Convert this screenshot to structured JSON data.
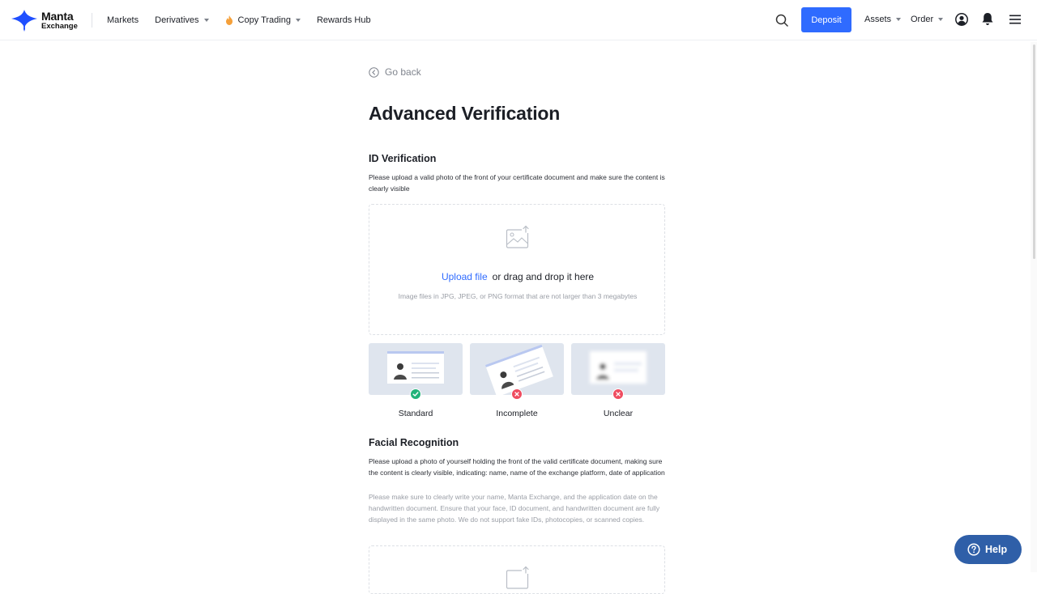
{
  "brand": {
    "name": "Manta",
    "sub": "Exchange"
  },
  "nav": {
    "markets": "Markets",
    "derivatives": "Derivatives",
    "copy_trading": "Copy Trading",
    "rewards_hub": "Rewards Hub",
    "deposit": "Deposit",
    "assets": "Assets",
    "order": "Order"
  },
  "page": {
    "go_back": "Go back",
    "title": "Advanced Verification"
  },
  "id_verification": {
    "heading": "ID Verification",
    "description": "Please upload a valid photo of the front of your certificate document and make sure the content is clearly visible",
    "upload_link": "Upload file",
    "upload_text": "or drag and drop it here",
    "upload_hint": "Image files in JPG, JPEG, or PNG format that are not larger than 3 megabytes",
    "samples": [
      {
        "label": "Standard",
        "status": "ok"
      },
      {
        "label": "Incomplete",
        "status": "bad"
      },
      {
        "label": "Unclear",
        "status": "bad"
      }
    ]
  },
  "facial_recognition": {
    "heading": "Facial Recognition",
    "description": "Please upload a photo of yourself holding the front of the valid certificate document, making sure the content is clearly visible, indicating: name, name of the exchange platform, date of application",
    "note": "Please make sure to clearly write your name, Manta Exchange, and the application date on the handwritten document. Ensure that your face, ID document, and handwritten document are fully displayed in the same photo. We do not support fake IDs, photocopies, or scanned copies."
  },
  "help": {
    "label": "Help"
  },
  "colors": {
    "accent": "#2f6bff",
    "success": "#22b37a",
    "error": "#ef4c60",
    "help_bg": "#2f5fa8"
  }
}
